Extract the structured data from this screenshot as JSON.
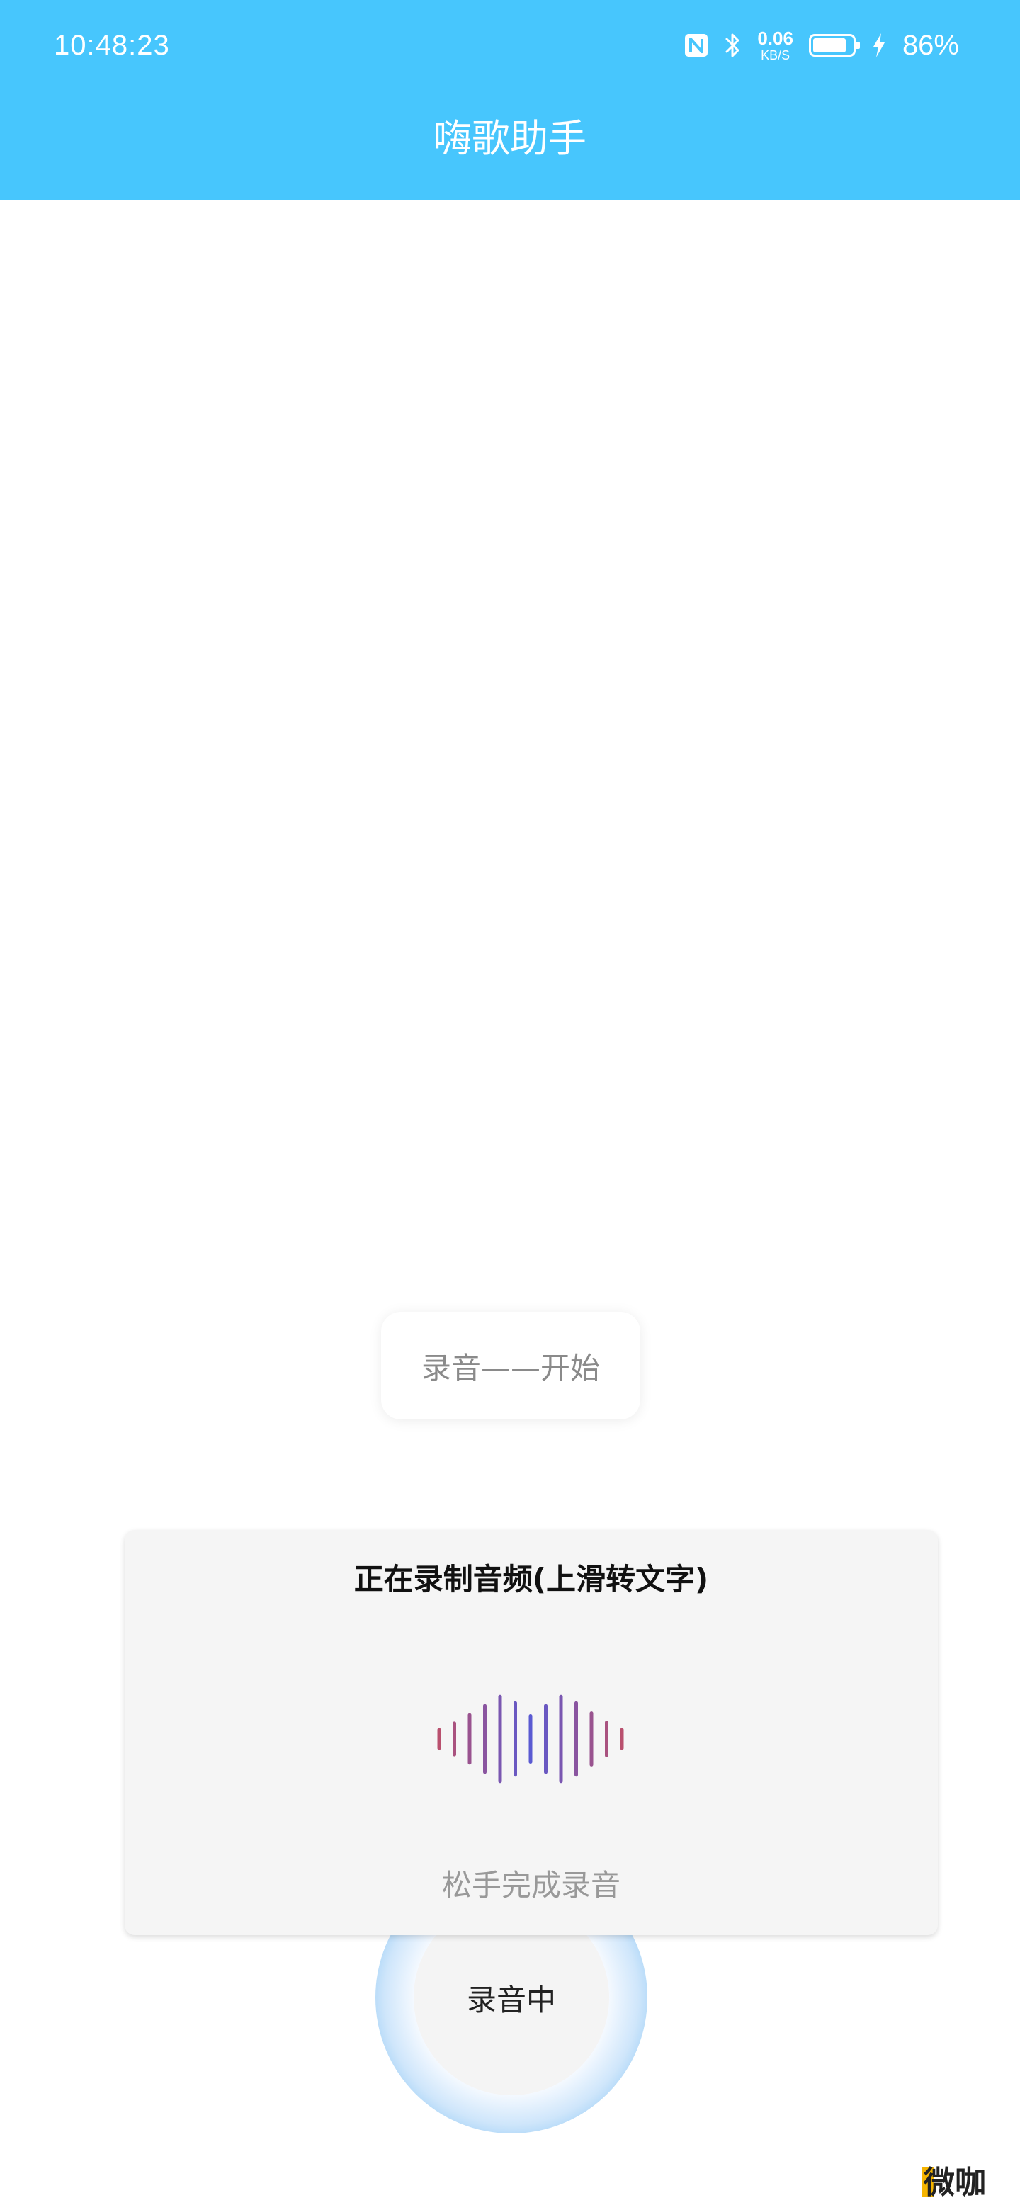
{
  "status_bar": {
    "time": "10:48:23",
    "net_speed_value": "0.06",
    "net_speed_unit": "KB/S",
    "battery_percent": "86%",
    "battery_level": 0.86
  },
  "header": {
    "title": "嗨歌助手",
    "background_color": "#47c6fd"
  },
  "start_pill": {
    "label": "录音——开始"
  },
  "recording_panel": {
    "title": "正在录制音频(上滑转文字)",
    "hint": "松手完成录音",
    "waveform_levels": [
      0.2,
      0.34,
      0.52,
      0.72,
      0.92,
      0.78,
      0.5,
      0.72,
      0.92,
      0.78,
      0.56,
      0.36,
      0.2
    ]
  },
  "record_button": {
    "label": "录音中"
  },
  "watermark": "微咖",
  "icons": {
    "nfc": "nfc-icon",
    "bluetooth": "bluetooth-icon",
    "battery": "battery-icon",
    "charging": "charging-icon"
  }
}
